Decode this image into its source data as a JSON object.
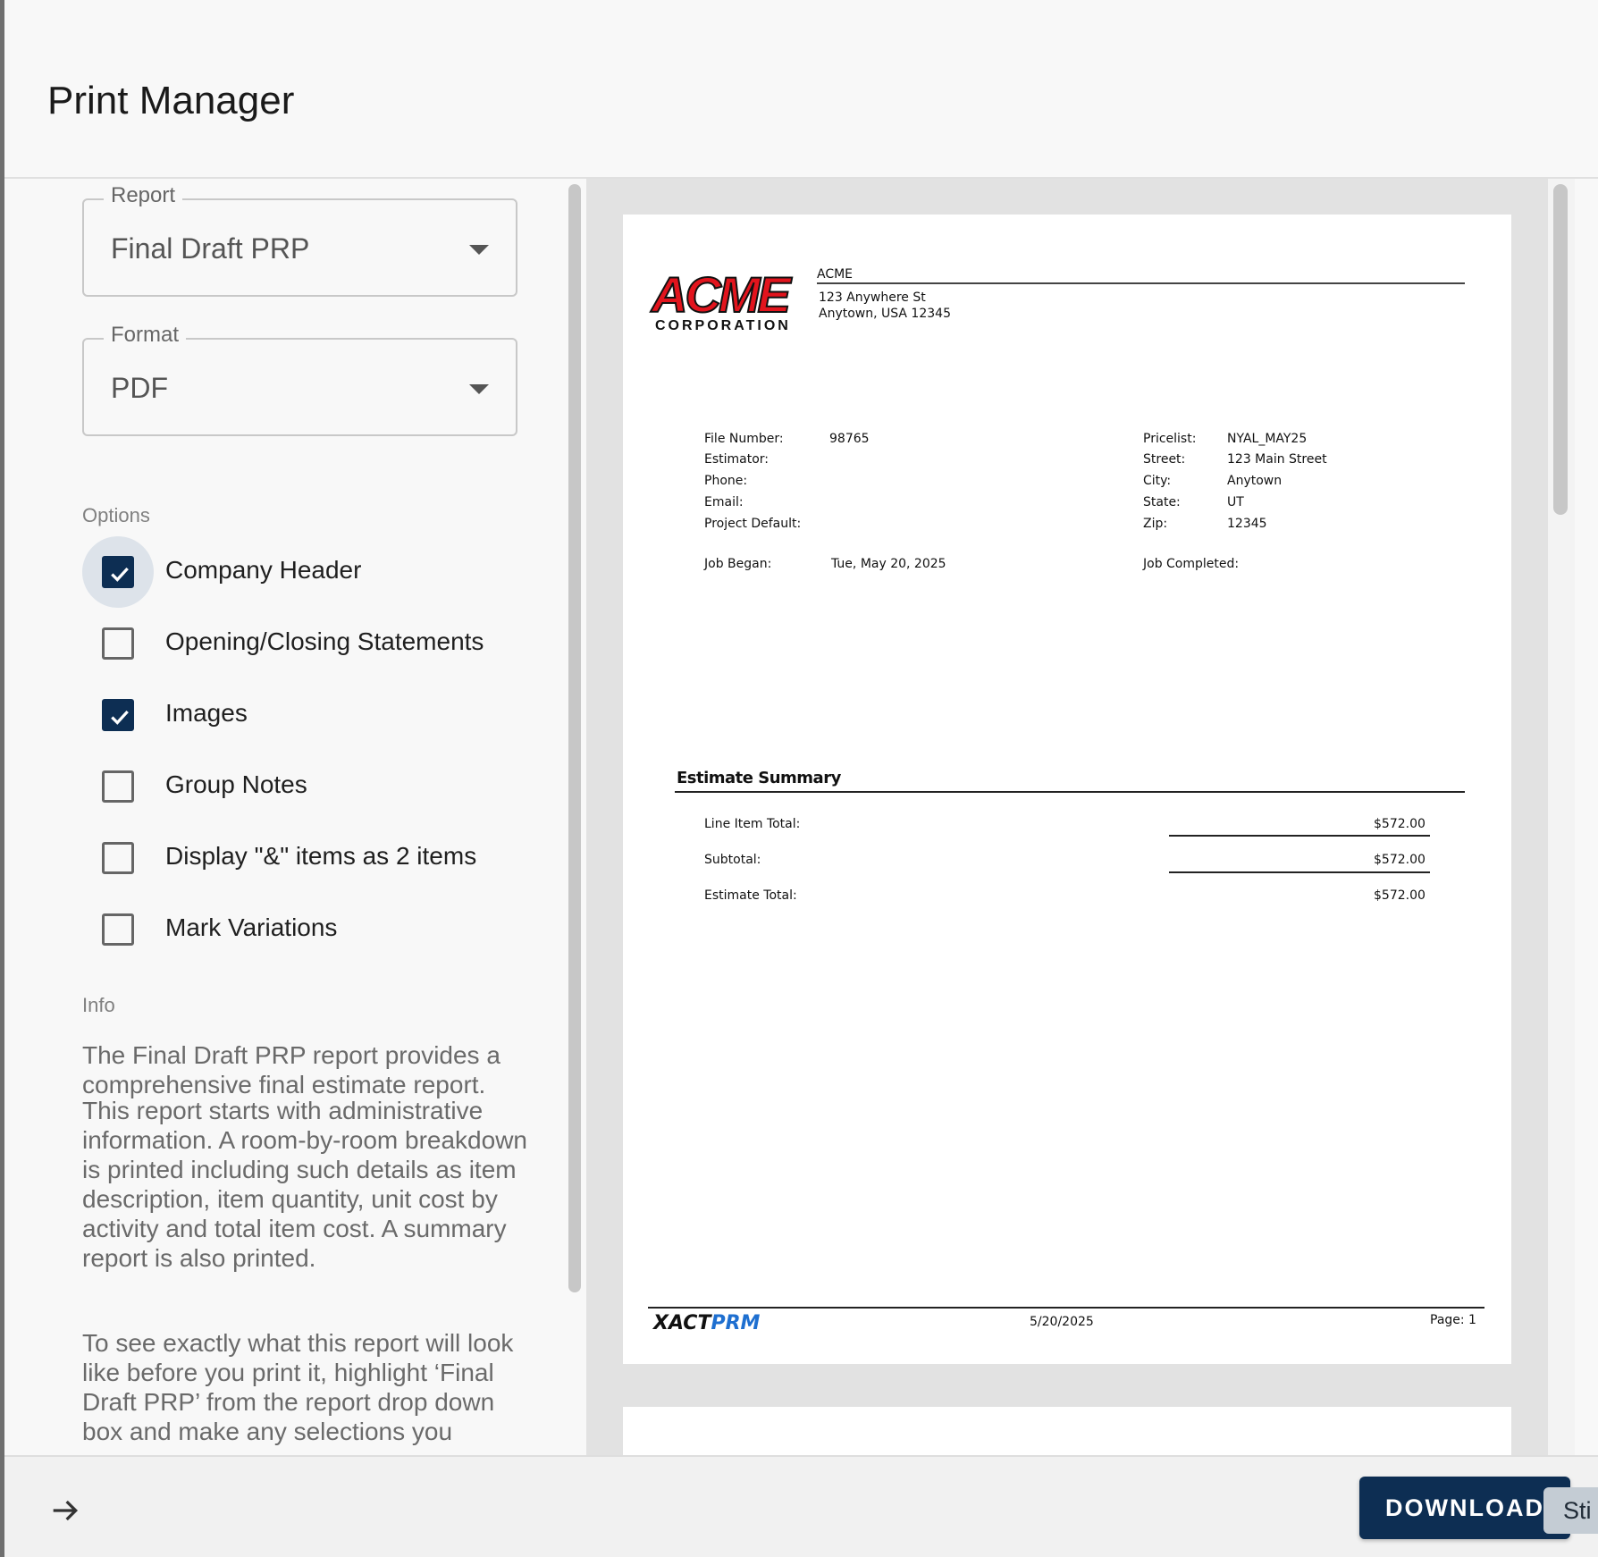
{
  "title": "Print Manager",
  "report_select": {
    "legend": "Report",
    "value": "Final Draft PRP"
  },
  "format_select": {
    "legend": "Format",
    "value": "PDF"
  },
  "options_label": "Options",
  "options": [
    {
      "label": "Company Header",
      "checked": true,
      "focused": true
    },
    {
      "label": "Opening/Closing Statements",
      "checked": false
    },
    {
      "label": "Images",
      "checked": true
    },
    {
      "label": "Group Notes",
      "checked": false
    },
    {
      "label": "Display \"&\" items as 2 items",
      "checked": false
    },
    {
      "label": "Mark Variations",
      "checked": false
    }
  ],
  "info_label": "Info",
  "info_paragraphs": [
    "The Final Draft PRP report provides a comprehensive final estimate report.",
    "This report starts with administrative information. A room-by-room breakdown is printed including such details as item description, item quantity, unit cost by activity and total item cost. A summary report is also printed.",
    "To see exactly what this report will look like before you print it, highlight ‘Final Draft PRP’ from the report drop down box and make any selections you"
  ],
  "preview": {
    "logo_text": "ACME",
    "logo_subtext": "CORPORATION",
    "company": {
      "name": "ACME",
      "address_line1": "123 Anywhere St",
      "address_line2": "Anytown, USA 12345"
    },
    "left_fields": [
      {
        "label": "File Number:",
        "value": "98765"
      },
      {
        "label": "Estimator:",
        "value": ""
      },
      {
        "label": "Phone:",
        "value": ""
      },
      {
        "label": "Email:",
        "value": ""
      },
      {
        "label": "Project Default:",
        "value": ""
      }
    ],
    "right_fields": [
      {
        "label": "Pricelist:",
        "value": "NYAL_MAY25"
      },
      {
        "label": "Street:",
        "value": "123 Main Street"
      },
      {
        "label": "City:",
        "value": "Anytown"
      },
      {
        "label": "State:",
        "value": "UT"
      },
      {
        "label": "Zip:",
        "value": "12345"
      }
    ],
    "job_began_label": "Job Began:",
    "job_began_value": "Tue, May 20, 2025",
    "job_completed_label": "Job Completed:",
    "summary_title": "Estimate Summary",
    "summary_rows": [
      {
        "label": "Line Item Total:",
        "value": "$572.00"
      },
      {
        "label": "Subtotal:",
        "value": "$572.00"
      },
      {
        "label": "Estimate Total:",
        "value": "$572.00"
      }
    ],
    "footer_logo_part1": "XACT",
    "footer_logo_part2": "PRM",
    "footer_date": "5/20/2025",
    "footer_page": "Page: 1"
  },
  "download_label": "DOWNLOAD",
  "sticky_label": "Sti",
  "colors": {
    "primary": "#0d2e53",
    "logo_red": "#e2141d",
    "prm_blue": "#1e6fd0"
  },
  "icons": {
    "arrow": "arrow-right-icon",
    "caret": "caret-down-icon",
    "check": "check-icon"
  }
}
